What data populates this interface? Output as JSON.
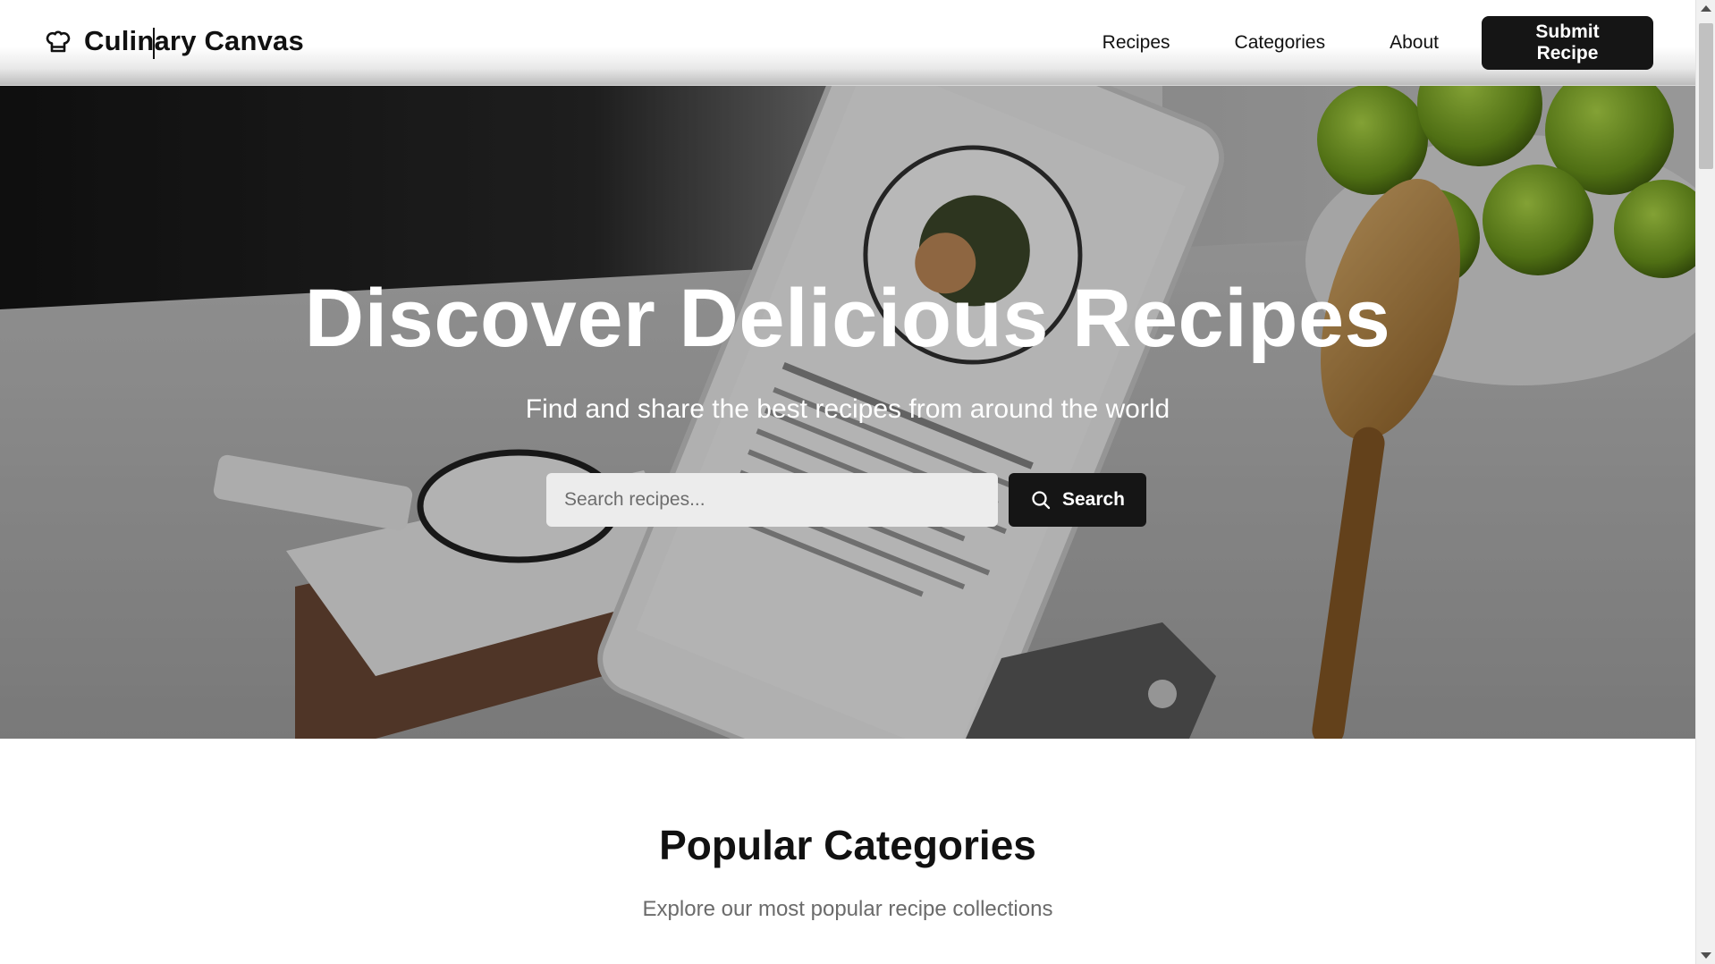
{
  "header": {
    "brand_name": "Culinary Canvas",
    "brand_icon": "chef-hat-icon",
    "nav": {
      "recipes": "Recipes",
      "categories": "Categories",
      "about": "About"
    },
    "submit_label": "Submit Recipe"
  },
  "hero": {
    "title": "Discover Delicious Recipes",
    "subtitle": "Find and share the best recipes from around the world",
    "search_placeholder": "Search recipes...",
    "search_value": "",
    "search_button_label": "Search",
    "search_icon": "search-icon"
  },
  "popular": {
    "title": "Popular Categories",
    "subtitle": "Explore our most popular recipe collections"
  },
  "colors": {
    "primary_button": "#151515",
    "text": "#111111",
    "muted_text": "#6b6b6b",
    "search_field": "#ececec"
  }
}
